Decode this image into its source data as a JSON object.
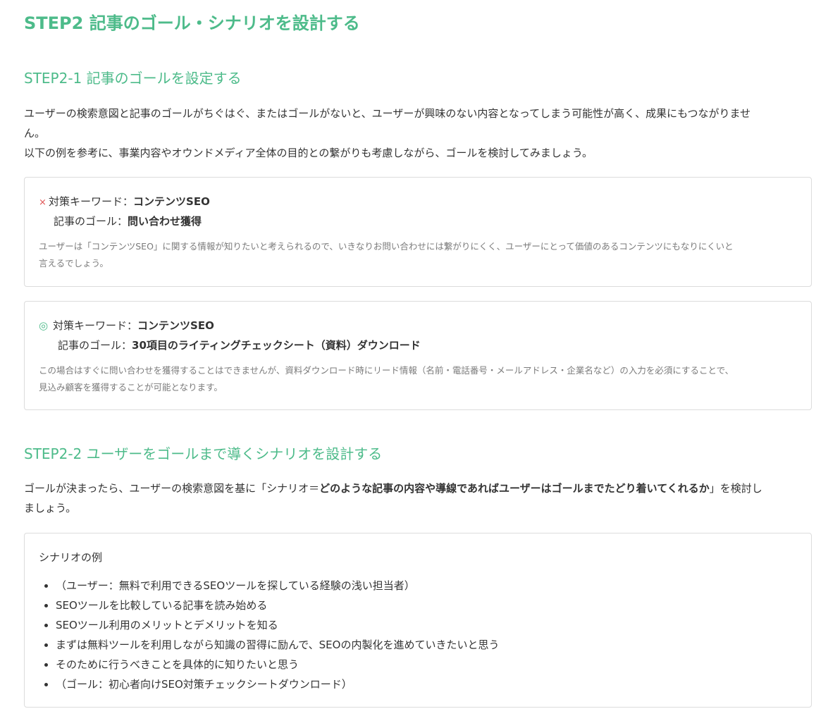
{
  "heading_main": "STEP2 記事のゴール・シナリオを設計する",
  "section1": {
    "heading": "STEP2-1 記事のゴールを設定する",
    "para_line1": "ユーザーの検索意図と記事のゴールがちぐはぐ、またはゴールがないと、ユーザーが興味のない内容となってしまう可能性が高く、成果にもつながりませ",
    "para_line2": "ん。",
    "para2": "以下の例を参考に、事業内容やオウンドメディア全体の目的との繋がりも考慮しながら、ゴールを検討してみましょう。",
    "bad_example": {
      "mark": "×",
      "keyword_label": "対策キーワード：",
      "keyword_value": "コンテンツSEO",
      "goal_label": "記事のゴール：",
      "goal_value": "問い合わせ獲得",
      "note_line1": "ユーザーは「コンテンツSEO」に関する情報が知りたいと考えられるので、いきなりお問い合わせには繋がりにくく、ユーザーにとって価値のあるコンテンツにもなりにくいと",
      "note_line2": "言えるでしょう。"
    },
    "good_example": {
      "mark": "◎",
      "keyword_label": "対策キーワード：",
      "keyword_value": "コンテンツSEO",
      "goal_label": "記事のゴール：",
      "goal_value": "30項目のライティングチェックシート（資料）ダウンロード",
      "note_line1": "この場合はすぐに問い合わせを獲得することはできませんが、資料ダウンロード時にリード情報（名前・電話番号・メールアドレス・企業名など）の入力を必須にすることで、",
      "note_line2": "見込み顧客を獲得することが可能となります。"
    }
  },
  "section2": {
    "heading": "STEP2-2 ユーザーをゴールまで導くシナリオを設計する",
    "para_pre": "ゴールが決まったら、ユーザーの検索意図を基に「シナリオ＝",
    "para_bold": "どのような記事の内容や導線であればユーザーはゴールまでたどり着いてくれるか",
    "para_post": "」を検討し",
    "para_line2": "ましょう。",
    "scenario_title": "シナリオの例",
    "scenario_items": [
      "（ユーザー：無料で利用できるSEOツールを探している経験の浅い担当者）",
      "SEOツールを比較している記事を読み始める",
      "SEOツール利用のメリットとデメリットを知る",
      "まずは無料ツールを利用しながら知識の習得に励んで、SEOの内製化を進めていきたいと思う",
      "そのために行うべきことを具体的に知りたいと思う",
      "（ゴール：初心者向けSEO対策チェックシートダウンロード）"
    ]
  },
  "colors": {
    "accent_green": "#4dbb8a",
    "cross_red": "#e05555",
    "note_gray": "#7b7b7b",
    "border": "#dcdcdc"
  }
}
